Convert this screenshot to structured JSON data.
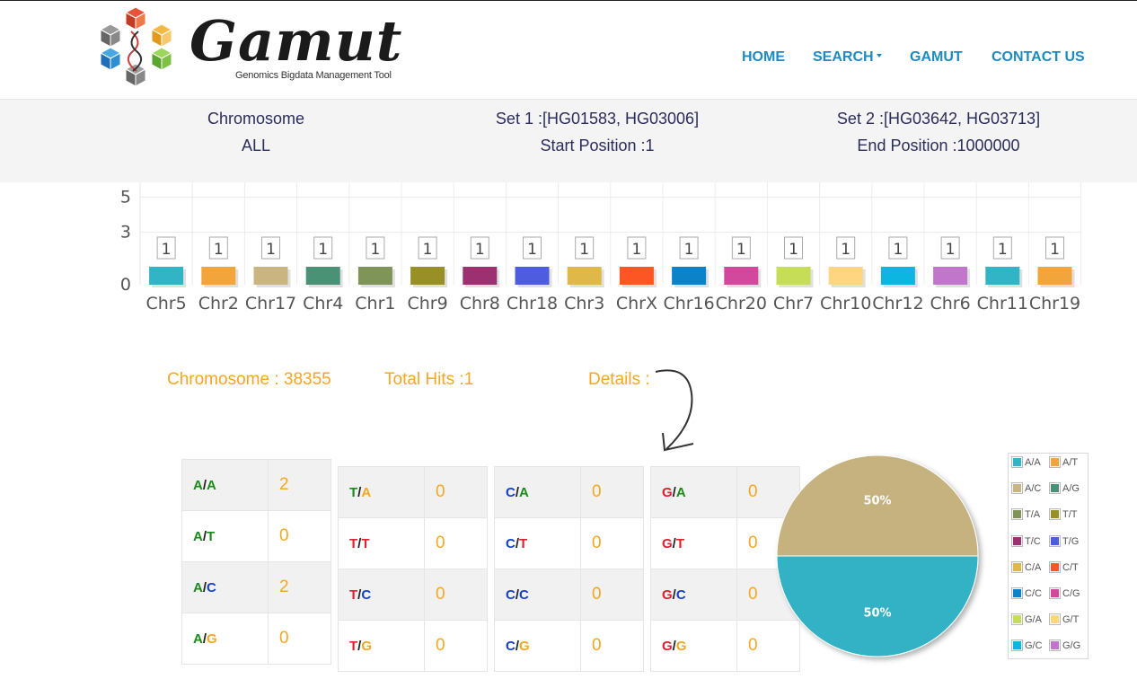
{
  "brand": {
    "name": "Gamut",
    "subtitle": "Genomics Bigdata Management Tool"
  },
  "nav": {
    "home": "HOME",
    "search": "SEARCH",
    "gamut": "GAMUT",
    "contact": "CONTACT US"
  },
  "info": {
    "chromosome_label": "Chromosome",
    "chromosome_value": "ALL",
    "set1": "Set 1 :[HG01583, HG03006]",
    "start": "Start Position :1",
    "set2": "Set 2 :[HG03642, HG03713]",
    "end": "End Position :1000000"
  },
  "chart_data": {
    "type": "bar",
    "categories": [
      "Chr5",
      "Chr2",
      "Chr17",
      "Chr4",
      "Chr1",
      "Chr9",
      "Chr8",
      "Chr18",
      "Chr3",
      "ChrX",
      "Chr16",
      "Chr20",
      "Chr7",
      "Chr10",
      "Chr12",
      "Chr6",
      "Chr11",
      "Chr19"
    ],
    "values": [
      1,
      1,
      1,
      1,
      1,
      1,
      1,
      1,
      1,
      1,
      1,
      1,
      1,
      1,
      1,
      1,
      1,
      1
    ],
    "data_labels": [
      "1",
      "1",
      "1",
      "1",
      "1",
      "1",
      "1",
      "1",
      "1",
      "1",
      "1",
      "1",
      "1",
      "1",
      "1",
      "1",
      "1",
      "1"
    ],
    "colors": [
      "#31b4c5",
      "#f2a53a",
      "#c9b482",
      "#4a9275",
      "#7f9459",
      "#988f27",
      "#9c3070",
      "#4e5de0",
      "#dfb84a",
      "#fb5624",
      "#0c82c8",
      "#d1489c",
      "#c6dd58",
      "#fed581",
      "#0db5e1",
      "#c176cb",
      "#31b4c5",
      "#f2a53a"
    ],
    "y_ticks": [
      "0",
      "3",
      "5"
    ],
    "ylim": [
      0,
      5
    ],
    "grid": true
  },
  "stats": {
    "chromosome": "Chromosome : 38355",
    "total_hits": "Total Hits :1",
    "details": "Details :"
  },
  "tables": [
    {
      "rows": [
        {
          "a": "A",
          "b": "A",
          "ca": "cA",
          "cb": "cA",
          "count": "2"
        },
        {
          "a": "A",
          "b": "T",
          "ca": "cA",
          "cb": "cA",
          "count": "0"
        },
        {
          "a": "A",
          "b": "C",
          "ca": "cA",
          "cb": "cC",
          "count": "2"
        },
        {
          "a": "A",
          "b": "G",
          "ca": "cA",
          "cb": "cG",
          "count": "0"
        }
      ]
    },
    {
      "rows": [
        {
          "a": "T",
          "b": "A",
          "ca": "cA",
          "cb": "cG",
          "count": "0"
        },
        {
          "a": "T",
          "b": "T",
          "ca": "cT",
          "cb": "cT",
          "count": "0"
        },
        {
          "a": "T",
          "b": "C",
          "ca": "cT",
          "cb": "cC",
          "count": "0"
        },
        {
          "a": "T",
          "b": "G",
          "ca": "cT",
          "cb": "cG",
          "count": "0"
        }
      ]
    },
    {
      "rows": [
        {
          "a": "C",
          "b": "A",
          "ca": "cC",
          "cb": "cA",
          "count": "0"
        },
        {
          "a": "C",
          "b": "T",
          "ca": "cC",
          "cb": "cT",
          "count": "0"
        },
        {
          "a": "C",
          "b": "C",
          "ca": "cC",
          "cb": "cC",
          "count": "0"
        },
        {
          "a": "C",
          "b": "G",
          "ca": "cC",
          "cb": "cG",
          "count": "0"
        }
      ]
    },
    {
      "rows": [
        {
          "a": "G",
          "b": "A",
          "ca": "cT",
          "cb": "cA",
          "count": "0"
        },
        {
          "a": "G",
          "b": "T",
          "ca": "cT",
          "cb": "cT",
          "count": "0"
        },
        {
          "a": "G",
          "b": "C",
          "ca": "cT",
          "cb": "cC",
          "count": "0"
        },
        {
          "a": "G",
          "b": "G",
          "ca": "cT",
          "cb": "cG",
          "count": "0"
        }
      ]
    }
  ],
  "pie": {
    "slices": [
      {
        "label": "A/C",
        "value": 50,
        "text": "50%",
        "color": "#c6b27e"
      },
      {
        "label": "A/A",
        "value": 50,
        "text": "50%",
        "color": "#31b2c4"
      }
    ]
  },
  "legend": [
    {
      "label": "A/A",
      "color": "#31b4c5"
    },
    {
      "label": "A/T",
      "color": "#f2a53a"
    },
    {
      "label": "A/C",
      "color": "#c9b482"
    },
    {
      "label": "A/G",
      "color": "#4a9275"
    },
    {
      "label": "T/A",
      "color": "#7f9459"
    },
    {
      "label": "T/T",
      "color": "#988f27"
    },
    {
      "label": "T/C",
      "color": "#9c3070"
    },
    {
      "label": "T/G",
      "color": "#4e5de0"
    },
    {
      "label": "C/A",
      "color": "#dfb84a"
    },
    {
      "label": "C/T",
      "color": "#fb5624"
    },
    {
      "label": "C/C",
      "color": "#0c82c8"
    },
    {
      "label": "C/G",
      "color": "#d1489c"
    },
    {
      "label": "G/A",
      "color": "#c6dd58"
    },
    {
      "label": "G/T",
      "color": "#fed581"
    },
    {
      "label": "G/C",
      "color": "#0db5e1"
    },
    {
      "label": "G/G",
      "color": "#c176cb"
    }
  ]
}
